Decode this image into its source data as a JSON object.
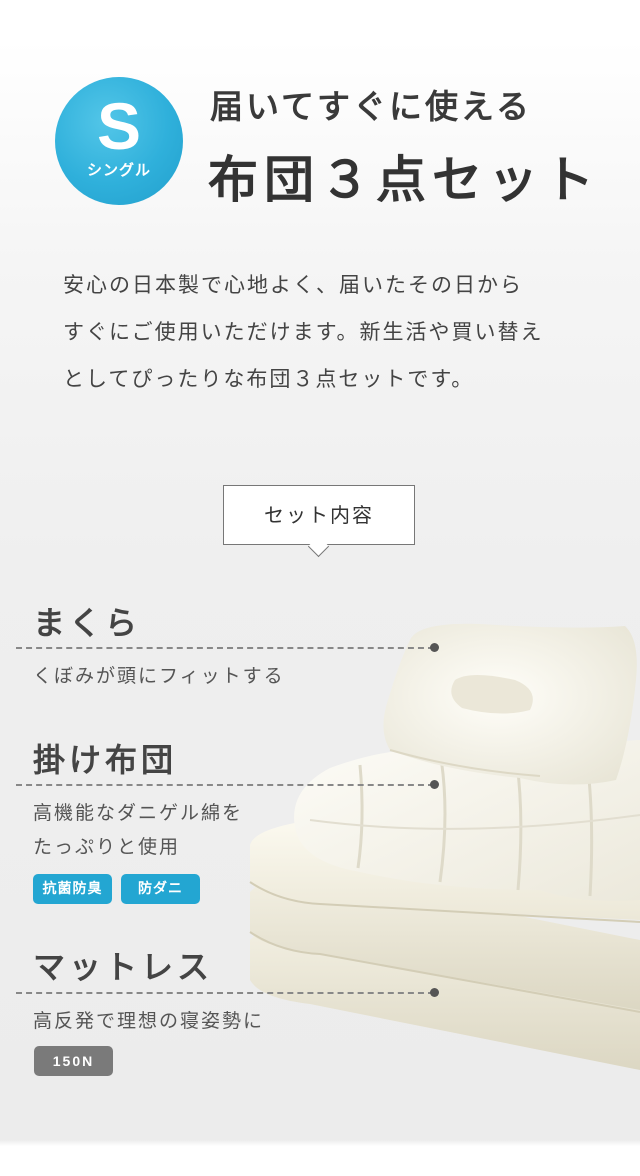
{
  "badge": {
    "letter": "S",
    "label": "シングル",
    "color": "#2fb0db"
  },
  "title": {
    "line1": "届いてすぐに使える",
    "line2": "布団３点セット"
  },
  "intro": [
    "安心の日本製で心地よく、届いたその日から",
    "すぐにご使用いただけます。新生活や買い替え",
    "としてぴったりな布団３点セットです。"
  ],
  "section_label": "セット内容",
  "items": [
    {
      "name": "まくら",
      "desc": [
        "くぼみが頭にフィットする"
      ],
      "tags": []
    },
    {
      "name": "掛け布団",
      "desc": [
        "高機能なダニゲル綿を",
        "たっぷりと使用"
      ],
      "tags": [
        "抗菌防臭",
        "防ダニ"
      ]
    },
    {
      "name": "マットレス",
      "desc": [
        "高反発で理想の寝姿勢に"
      ],
      "tags": [
        "150N"
      ]
    }
  ],
  "colors": {
    "accent": "#23a6d2",
    "tag_gray": "#7a7a7a"
  }
}
